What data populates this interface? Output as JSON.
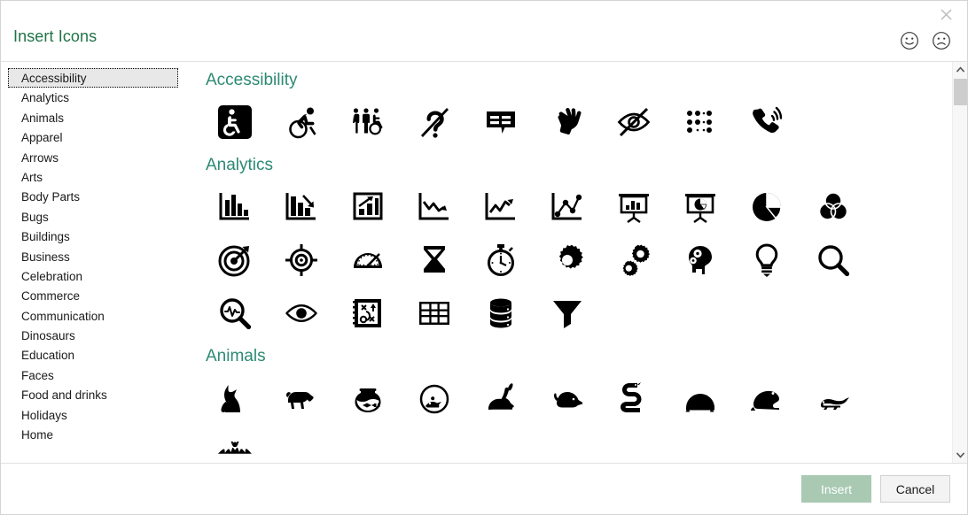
{
  "dialog": {
    "title": "Insert Icons",
    "close_icon": "close-icon",
    "feedback_happy_icon": "smiley-happy-icon",
    "feedback_sad_icon": "smiley-sad-icon"
  },
  "sidebar": {
    "selected": "Accessibility",
    "items": [
      {
        "label": "Accessibility",
        "selected": true
      },
      {
        "label": "Analytics",
        "selected": false
      },
      {
        "label": "Animals",
        "selected": false
      },
      {
        "label": "Apparel",
        "selected": false
      },
      {
        "label": "Arrows",
        "selected": false
      },
      {
        "label": "Arts",
        "selected": false
      },
      {
        "label": "Body Parts",
        "selected": false
      },
      {
        "label": "Bugs",
        "selected": false
      },
      {
        "label": "Buildings",
        "selected": false
      },
      {
        "label": "Business",
        "selected": false
      },
      {
        "label": "Celebration",
        "selected": false
      },
      {
        "label": "Commerce",
        "selected": false
      },
      {
        "label": "Communication",
        "selected": false
      },
      {
        "label": "Dinosaurs",
        "selected": false
      },
      {
        "label": "Education",
        "selected": false
      },
      {
        "label": "Faces",
        "selected": false
      },
      {
        "label": "Food and drinks",
        "selected": false
      },
      {
        "label": "Holidays",
        "selected": false
      },
      {
        "label": "Home",
        "selected": false
      }
    ]
  },
  "gallery": {
    "sections": [
      {
        "title": "Accessibility",
        "icons": [
          "wheelchair-sign-icon",
          "wheelchair-racer-icon",
          "people-wheelchair-icon",
          "hearing-impaired-icon",
          "closed-captions-icon",
          "sign-language-icon",
          "vision-impaired-icon",
          "braille-icon",
          "phone-ringing-icon"
        ]
      },
      {
        "title": "Analytics",
        "icons": [
          "bar-chart-icon",
          "bar-chart-down-icon",
          "bar-chart-up-icon",
          "line-chart-down-icon",
          "line-chart-up-icon",
          "scatter-chart-icon",
          "presentation-bar-chart-icon",
          "presentation-pie-chart-icon",
          "pie-chart-icon",
          "venn-diagram-icon",
          "target-arrow-icon",
          "crosshair-target-icon",
          "gauge-icon",
          "hourglass-icon",
          "stopwatch-icon",
          "gear-icon",
          "gears-icon",
          "head-gears-icon",
          "lightbulb-icon",
          "magnifier-icon",
          "magnifier-pulse-icon",
          "eye-icon",
          "strategy-board-icon",
          "table-grid-icon",
          "database-icon",
          "funnel-filter-icon"
        ]
      },
      {
        "title": "Animals",
        "icons": [
          "cat-icon",
          "dog-icon",
          "fishbowl-icon",
          "hamster-ball-icon",
          "rabbit-icon",
          "mouse-icon",
          "snake-icon",
          "turtle-icon",
          "frog-icon",
          "lizard-icon",
          "bat-icon"
        ]
      }
    ]
  },
  "scrollbar": {
    "up_icon": "chevron-up-icon",
    "down_icon": "chevron-down-icon"
  },
  "footer": {
    "insert_label": "Insert",
    "cancel_label": "Cancel"
  },
  "colors": {
    "title_green": "#217346",
    "section_header": "#2d8a72",
    "insert_button": "#a9c9b3",
    "selection_bg": "#e8e8e8"
  }
}
